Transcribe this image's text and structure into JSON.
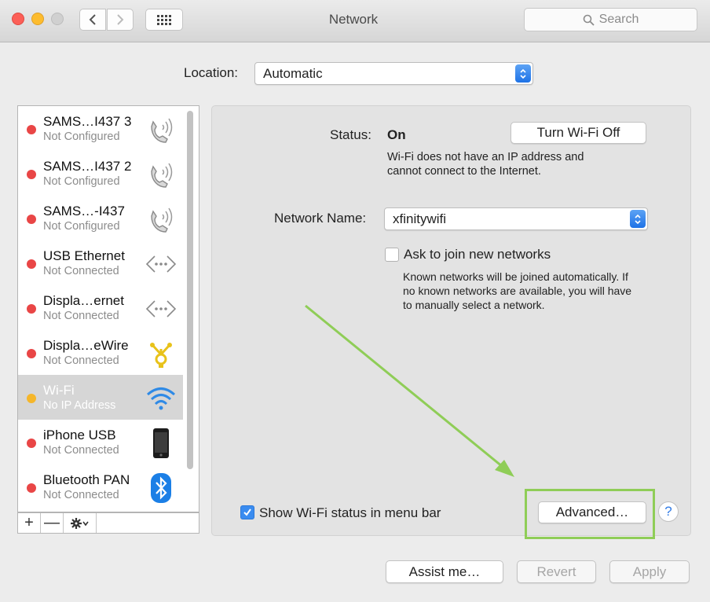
{
  "window": {
    "title": "Network"
  },
  "toolbar": {
    "search_placeholder": "Search"
  },
  "location": {
    "label": "Location:",
    "value": "Automatic"
  },
  "services": [
    {
      "name": "SAMS…I437 3",
      "status": "Not Configured",
      "status_color": "#e94646",
      "icon": "phone-wireless-icon"
    },
    {
      "name": "SAMS…I437 2",
      "status": "Not Configured",
      "status_color": "#e94646",
      "icon": "phone-wireless-icon"
    },
    {
      "name": "SAMS…-I437",
      "status": "Not Configured",
      "status_color": "#e94646",
      "icon": "phone-wireless-icon"
    },
    {
      "name": "USB Ethernet",
      "status": "Not Connected",
      "status_color": "#e94646",
      "icon": "ethernet-icon"
    },
    {
      "name": "Displa…ernet",
      "status": "Not Connected",
      "status_color": "#e94646",
      "icon": "ethernet-icon"
    },
    {
      "name": "Displa…eWire",
      "status": "Not Connected",
      "status_color": "#e94646",
      "icon": "firewire-icon"
    },
    {
      "name": "Wi-Fi",
      "status": "No IP Address",
      "status_color": "#f5b62a",
      "icon": "wifi-icon",
      "selected": true
    },
    {
      "name": "iPhone USB",
      "status": "Not Connected",
      "status_color": "#e94646",
      "icon": "iphone-icon"
    },
    {
      "name": "Bluetooth PAN",
      "status": "Not Connected",
      "status_color": "#e94646",
      "icon": "bluetooth-icon"
    }
  ],
  "sidebar_toolbar": {
    "add": "+",
    "remove": "—"
  },
  "detail": {
    "status_label": "Status:",
    "status_value": "On",
    "turn_off_button": "Turn Wi-Fi Off",
    "status_message_1": "Wi-Fi does not have an IP address and",
    "status_message_2": "cannot connect to the Internet.",
    "network_name_label": "Network Name:",
    "network_name_value": "xfinitywifi",
    "ask_join_label": "Ask to join new networks",
    "ask_join_checked": false,
    "ask_join_help_1": "Known networks will be joined automatically. If",
    "ask_join_help_2": "no known networks are available, you will have",
    "ask_join_help_3": "to manually select a network.",
    "show_status_label": "Show Wi-Fi status in menu bar",
    "show_status_checked": true,
    "advanced_button": "Advanced…",
    "help_button": "?"
  },
  "footer": {
    "assist": "Assist me…",
    "revert": "Revert",
    "apply": "Apply"
  },
  "colors": {
    "accent": "#2f7ae5",
    "annotation": "#8fcd57"
  }
}
